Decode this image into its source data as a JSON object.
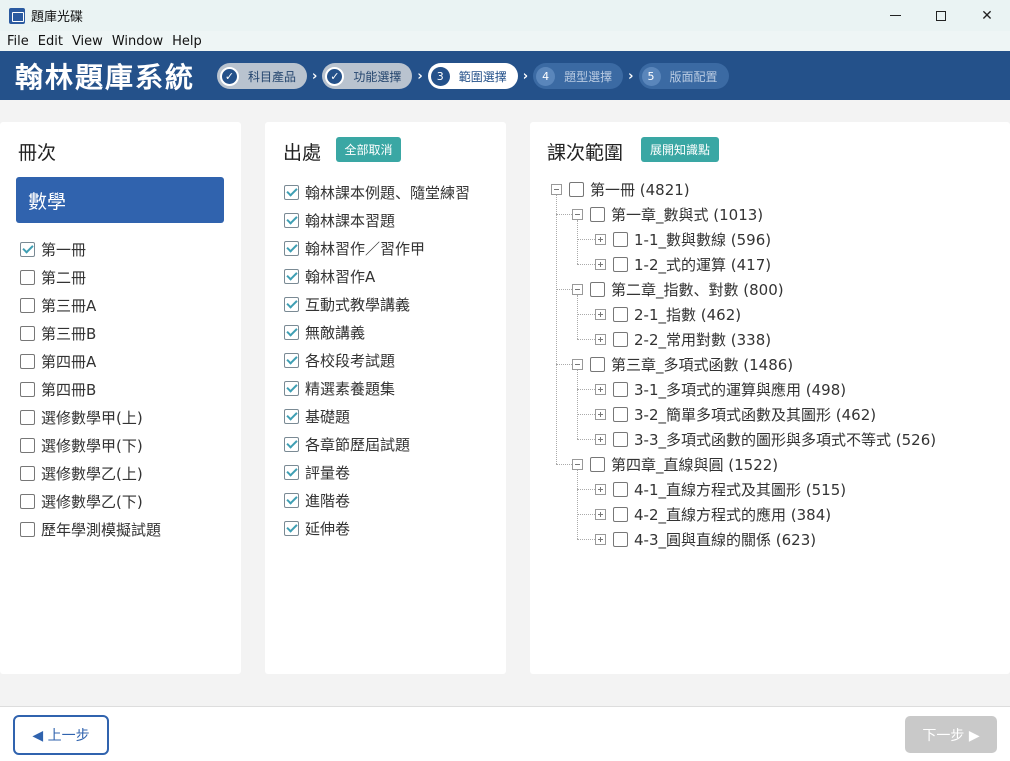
{
  "window": {
    "title": "題庫光碟"
  },
  "menu": [
    "File",
    "Edit",
    "View",
    "Window",
    "Help"
  ],
  "header": {
    "brand": "翰林題庫系統",
    "steps": [
      {
        "num": "✓",
        "label": "科目產品",
        "state": "done"
      },
      {
        "num": "✓",
        "label": "功能選擇",
        "state": "done"
      },
      {
        "num": "3",
        "label": "範圍選擇",
        "state": "active"
      },
      {
        "num": "4",
        "label": "題型選擇",
        "state": "todo"
      },
      {
        "num": "5",
        "label": "版面配置",
        "state": "todo"
      }
    ]
  },
  "volumes": {
    "title": "冊次",
    "subject": "數學",
    "items": [
      {
        "label": "第一冊",
        "checked": true
      },
      {
        "label": "第二冊",
        "checked": false
      },
      {
        "label": "第三冊A",
        "checked": false
      },
      {
        "label": "第三冊B",
        "checked": false
      },
      {
        "label": "第四冊A",
        "checked": false
      },
      {
        "label": "第四冊B",
        "checked": false
      },
      {
        "label": "選修數學甲(上)",
        "checked": false
      },
      {
        "label": "選修數學甲(下)",
        "checked": false
      },
      {
        "label": "選修數學乙(上)",
        "checked": false
      },
      {
        "label": "選修數學乙(下)",
        "checked": false
      },
      {
        "label": "歷年學測模擬試題",
        "checked": false
      }
    ]
  },
  "sources": {
    "title": "出處",
    "deselect_all": "全部取消",
    "items": [
      {
        "label": "翰林課本例題、隨堂練習",
        "checked": true
      },
      {
        "label": "翰林課本習題",
        "checked": true
      },
      {
        "label": "翰林習作／習作甲",
        "checked": true
      },
      {
        "label": "翰林習作A",
        "checked": true
      },
      {
        "label": "互動式教學講義",
        "checked": true
      },
      {
        "label": "無敵講義",
        "checked": true
      },
      {
        "label": "各校段考試題",
        "checked": true
      },
      {
        "label": "精選素養題集",
        "checked": true
      },
      {
        "label": "基礎題",
        "checked": true
      },
      {
        "label": "各章節歷屆試題",
        "checked": true
      },
      {
        "label": "評量卷",
        "checked": true
      },
      {
        "label": "進階卷",
        "checked": true
      },
      {
        "label": "延伸卷",
        "checked": true
      }
    ]
  },
  "scope": {
    "title": "課次範圍",
    "expand_label": "展開知識點",
    "tree": [
      {
        "label": "第一冊 (4821)",
        "level": 0,
        "toggle": "minus"
      },
      {
        "label": "第一章_數與式 (1013)",
        "level": 1,
        "toggle": "minus"
      },
      {
        "label": "1-1_數與數線 (596)",
        "level": 2,
        "toggle": "plus"
      },
      {
        "label": "1-2_式的運算 (417)",
        "level": 2,
        "toggle": "plus"
      },
      {
        "label": "第二章_指數、對數 (800)",
        "level": 1,
        "toggle": "minus"
      },
      {
        "label": "2-1_指數 (462)",
        "level": 2,
        "toggle": "plus"
      },
      {
        "label": "2-2_常用對數 (338)",
        "level": 2,
        "toggle": "plus"
      },
      {
        "label": "第三章_多項式函數 (1486)",
        "level": 1,
        "toggle": "minus"
      },
      {
        "label": "3-1_多項式的運算與應用 (498)",
        "level": 2,
        "toggle": "plus"
      },
      {
        "label": "3-2_簡單多項式函數及其圖形 (462)",
        "level": 2,
        "toggle": "plus"
      },
      {
        "label": "3-3_多項式函數的圖形與多項式不等式 (526)",
        "level": 2,
        "toggle": "plus"
      },
      {
        "label": "第四章_直線與圓 (1522)",
        "level": 1,
        "toggle": "minus"
      },
      {
        "label": "4-1_直線方程式及其圖形 (515)",
        "level": 2,
        "toggle": "plus"
      },
      {
        "label": "4-2_直線方程式的應用 (384)",
        "level": 2,
        "toggle": "plus"
      },
      {
        "label": "4-3_圓與直線的關係 (623)",
        "level": 2,
        "toggle": "plus"
      }
    ]
  },
  "footer": {
    "prev": "◀ 上一步",
    "next": "下一步 ▶"
  }
}
